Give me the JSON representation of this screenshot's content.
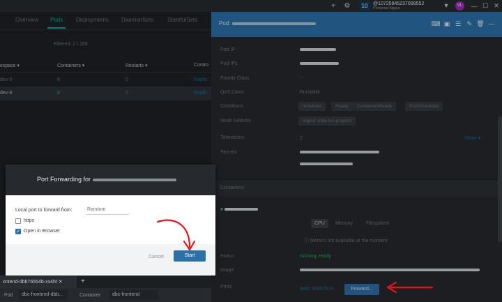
{
  "topbar": {
    "badge": "10",
    "account_name": "@10725845237088552",
    "account_sub": "Personal Space",
    "avatar": "VL"
  },
  "tabs": [
    "Overview",
    "Pods",
    "Deployments",
    "DaemonSets",
    "StatefulSets"
  ],
  "filtered": "Filtered: 2 / 160",
  "table": {
    "headers": [
      "espace",
      "Containers",
      "Restarts",
      "Contro"
    ],
    "rows": [
      {
        "ns": "dev-5",
        "containers": "8",
        "restarts": "0",
        "controller": "Replic"
      },
      {
        "ns": "dev-6",
        "containers": "8",
        "restarts": "0",
        "controller": "Replic"
      }
    ]
  },
  "panel": {
    "title_prefix": "Pod:",
    "labels": {
      "pod_ip": "Pod IP",
      "pod_ips": "Pod IPs",
      "priority": "Priority Class",
      "qos": "QoS Class",
      "conditions": "Conditions",
      "node_selector": "Node Selector",
      "tolerations": "Tolerations",
      "secrets": "Secrets",
      "status": "Status",
      "image": "Image",
      "ports": "Ports"
    },
    "priority_val": "--",
    "qos_val": "Burstable",
    "conditions": [
      "Initialized",
      "Ready",
      "ContainersReady",
      "PodScheduled"
    ],
    "node_selector_val": "region: rnda-tex-projects",
    "tolerations_val": "2",
    "show": "Show",
    "containers_section": "Containers",
    "metrics_tabs": [
      "CPU",
      "Memory",
      "Filesystem"
    ],
    "metrics_note": "Metrics not available at the moment",
    "status_val": "running, ready",
    "ports_val": "web: 3000/TCP",
    "forward_btn": "Forward..."
  },
  "dialog": {
    "title": "Port Forwarding for",
    "local_port_label": "Local port to forward from:",
    "local_port_placeholder": "Random",
    "https_label": "https",
    "open_browser_label": "Open in Browser",
    "cancel": "Cancel",
    "start": "Start"
  },
  "dock": {
    "tab_label": "ontend-dbb76554b-xx4ht",
    "add": "+",
    "pod_label": "Pod",
    "pod_value": "dbc-frontend-dbb...",
    "container_label": "Container",
    "container_value": "dbc-frontend"
  },
  "colors": {
    "accent": "#00a7a0",
    "primary": "#2c70a8",
    "arrow": "#e0141e"
  }
}
